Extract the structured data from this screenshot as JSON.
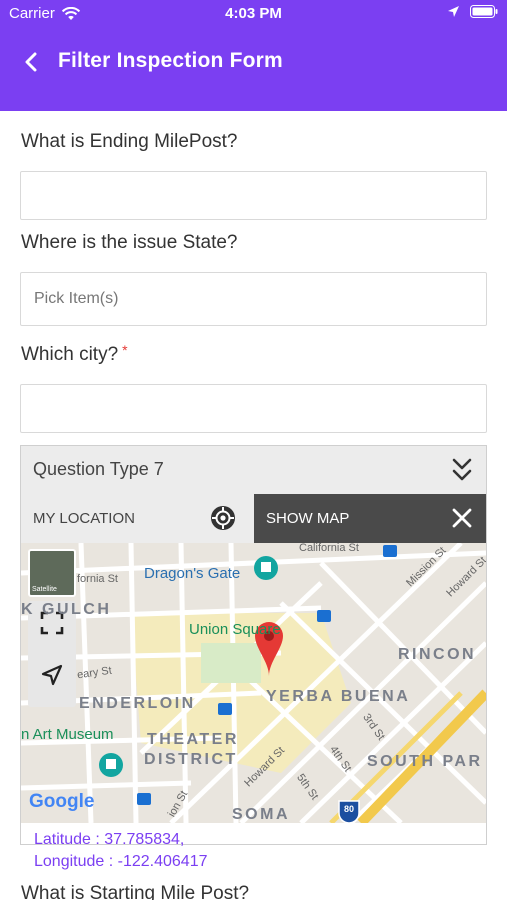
{
  "status": {
    "carrier": "Carrier",
    "time": "4:03 PM",
    "icons": [
      "wifi-icon",
      "location-arrow-icon",
      "battery-icon"
    ]
  },
  "nav": {
    "title": "Filter Inspection Form",
    "back_icon": "chevron-left-icon"
  },
  "colors": {
    "brand": "#7b3ff2",
    "required": "#e53935",
    "map_dark_button": "#4a4a4a"
  },
  "form": {
    "q1": {
      "label": "What is Ending MilePost?",
      "value": ""
    },
    "q2": {
      "label": "Where is the issue State?",
      "placeholder": "Pick Item(s)"
    },
    "q3": {
      "label": "Which city?",
      "required_mark": "*",
      "value": ""
    },
    "q4": {
      "title": "Question Type 7",
      "my_location": "MY LOCATION",
      "show_map": "SHOW MAP",
      "map": {
        "satellite_label": "Satellite",
        "attribution": "Google",
        "labels": {
          "california_st_top": "California St",
          "california_st_left": "fornia St",
          "dragons_gate": "Dragon's Gate",
          "mission_st": "Mission St",
          "howard_st_top": "Howard St",
          "gulch": "K GULCH",
          "union_square": "Union Square",
          "rincon": "RINCON",
          "geary_st": "eary St",
          "tenderloin": "ENDERLOIN",
          "yerba_buena": "YERBA BUENA",
          "art_museum": "n Art Museum",
          "third_st": "3rd St",
          "theater": "THEATER",
          "district": "DISTRICT",
          "howard_st": "Howard St",
          "fourth_st": "4th St",
          "south_park": "SOUTH PAR",
          "fifth_st": "5th St",
          "soma": "SOMA",
          "ion_st": "ion St",
          "highway": "80"
        }
      },
      "latitude": "Latitude : 37.785834,",
      "longitude": "Longitude : -122.406417"
    },
    "q5": {
      "label": "What is Starting Mile Post?"
    }
  }
}
